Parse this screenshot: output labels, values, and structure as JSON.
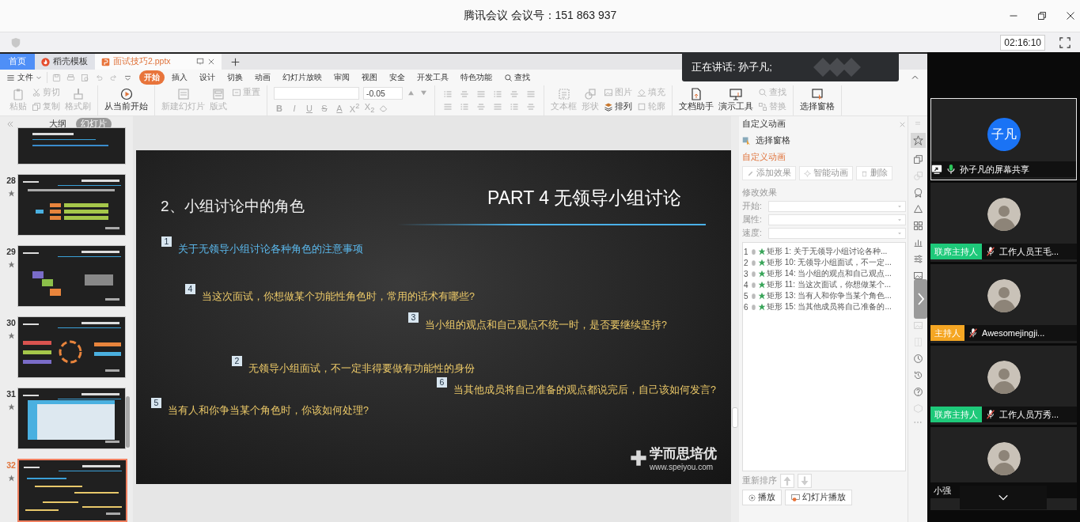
{
  "meeting": {
    "title": "腾讯会议 会议号：151 863 937",
    "timer": "02:16:10"
  },
  "toast": {
    "text": "正在讲话: 孙子凡;"
  },
  "doc_tabs": [
    {
      "label": "首页",
      "kind": "home",
      "selected": false
    },
    {
      "label": "稻壳模板",
      "kind": "docer",
      "selected": false
    },
    {
      "label": "面试技巧2.pptx",
      "kind": "file",
      "selected": true
    }
  ],
  "menu": {
    "file": "文件",
    "tabs": [
      {
        "label": "开始",
        "selected": true
      },
      {
        "label": "插入",
        "selected": false
      },
      {
        "label": "设计",
        "selected": false
      },
      {
        "label": "切换",
        "selected": false
      },
      {
        "label": "动画",
        "selected": false
      },
      {
        "label": "幻灯片放映",
        "selected": false
      },
      {
        "label": "审阅",
        "selected": false
      },
      {
        "label": "视图",
        "selected": false
      },
      {
        "label": "安全",
        "selected": false
      },
      {
        "label": "开发工具",
        "selected": false
      },
      {
        "label": "特色功能",
        "selected": false
      }
    ],
    "search": "查找"
  },
  "ribbon": [
    {
      "kind": "buttons",
      "items": [
        {
          "label": "粘贴",
          "kind": "large",
          "disabled": true
        },
        {
          "label": "剪切",
          "kind": "small",
          "disabled": true
        },
        {
          "label": "复制",
          "kind": "small",
          "disabled": true
        },
        {
          "label": "格式刷",
          "kind": "large",
          "disabled": true
        }
      ]
    },
    {
      "kind": "buttons",
      "items": [
        {
          "label": "从当前开始",
          "kind": "large",
          "disabled": false
        }
      ]
    },
    {
      "kind": "buttons",
      "items": [
        {
          "label": "新建幻灯片",
          "kind": "large",
          "disabled": true
        },
        {
          "label": "版式",
          "kind": "large",
          "disabled": true
        },
        {
          "label": "重置",
          "kind": "small",
          "disabled": true
        }
      ]
    },
    {
      "kind": "format",
      "size_value": "-0.05",
      "styles": [
        "B",
        "I",
        "U",
        "S",
        "A",
        "X$^{2}$",
        "X$_{2}$"
      ]
    },
    {
      "kind": "buttons",
      "items": [
        {
          "label": "文本框",
          "kind": "large",
          "disabled": true
        },
        {
          "label": "形状",
          "kind": "large",
          "disabled": true
        },
        {
          "label": "图片",
          "kind": "small",
          "disabled": true
        },
        {
          "label": "排列",
          "kind": "small",
          "disabled": false
        },
        {
          "label": "填充",
          "kind": "small",
          "disabled": true
        },
        {
          "label": "轮廓",
          "kind": "small",
          "disabled": true
        }
      ]
    },
    {
      "kind": "buttons",
      "items": [
        {
          "label": "文档助手",
          "kind": "large",
          "disabled": false
        },
        {
          "label": "演示工具",
          "kind": "large",
          "disabled": false
        },
        {
          "label": "查找",
          "kind": "small",
          "disabled": true
        },
        {
          "label": "替换",
          "kind": "small",
          "disabled": true
        }
      ]
    },
    {
      "kind": "buttons",
      "items": [
        {
          "label": "选择窗格",
          "kind": "large",
          "disabled": false
        }
      ]
    }
  ],
  "sidebar": {
    "tabs": [
      {
        "label": "大纲",
        "selected": false
      },
      {
        "label": "幻灯片",
        "selected": true
      }
    ],
    "slides": [
      {
        "selected": false
      },
      {
        "number": "28",
        "selected": false
      },
      {
        "number": "29",
        "selected": false
      },
      {
        "number": "30",
        "selected": false
      },
      {
        "number": "31",
        "selected": false
      },
      {
        "number": "32",
        "selected": true
      }
    ]
  },
  "slide": {
    "heading": "2、小组讨论中的角色",
    "part_title": "PART 4  无领导小组讨论",
    "items": [
      {
        "number": "1",
        "kind": "intro",
        "text": "关于无领导小组讨论各种角色的注意事项"
      },
      {
        "number": "4",
        "kind": "question",
        "text": "当这次面试，你想做某个功能性角色时，常用的话术有哪些?"
      },
      {
        "number": "3",
        "kind": "question",
        "text": "当小组的观点和自己观点不统一时，是否要继续坚持?"
      },
      {
        "number": "2",
        "kind": "question",
        "text": "无领导小组面试，不一定非得要做有功能性的身份"
      },
      {
        "number": "6",
        "kind": "question",
        "text": "当其他成员将自己准备的观点都说完后，自己该如何发言?"
      },
      {
        "number": "5",
        "kind": "question",
        "text": "当有人和你争当某个角色时，你该如何处理?"
      }
    ],
    "logo": "学而思培优",
    "url": "www.speiyou.com"
  },
  "animation": {
    "title": "自定义动画",
    "select_pane": "选择窗格",
    "section": "自定义动画",
    "actions": [
      "添加效果",
      "智能动画",
      "删除"
    ],
    "modify": "修改效果",
    "fields": [
      "开始:",
      "属性:",
      "速度:"
    ],
    "effects": [
      {
        "number": "1",
        "text": "矩形 1: 关于无领导小组讨论各种..."
      },
      {
        "number": "2",
        "text": "矩形 10: 无领导小组面试，不一定..."
      },
      {
        "number": "3",
        "text": "矩形 14: 当小组的观点和自己观点..."
      },
      {
        "number": "4",
        "text": "矩形 11: 当这次面试，你想做某个..."
      },
      {
        "number": "5",
        "text": "矩形 13: 当有人和你争当某个角色..."
      },
      {
        "number": "6",
        "text": "矩形 15: 当其他成员将自己准备的..."
      }
    ],
    "reorder": "重新排序",
    "buttons": [
      {
        "label": "播放",
        "kind": "play"
      },
      {
        "label": "幻灯片播放",
        "kind": "slideshow"
      }
    ]
  },
  "participants": [
    {
      "kind": "screen_share",
      "avatar_text": "子凡",
      "name": "孙子凡的屏幕共享",
      "selected": true,
      "muted": false
    },
    {
      "kind": "member",
      "role": "联席主持人",
      "color": "#1ec97a",
      "name": "工作人员王毛...",
      "selected": false,
      "muted": true
    },
    {
      "kind": "member",
      "role": "主持人",
      "color": "#f5a623",
      "name": "Awesomejingji...",
      "selected": false,
      "muted": true
    },
    {
      "kind": "member",
      "role": "联席主持人",
      "color": "#1ec97a",
      "name": "工作人员万秀...",
      "selected": false,
      "muted": true
    },
    {
      "kind": "member",
      "name": "小强",
      "selected": false
    }
  ]
}
